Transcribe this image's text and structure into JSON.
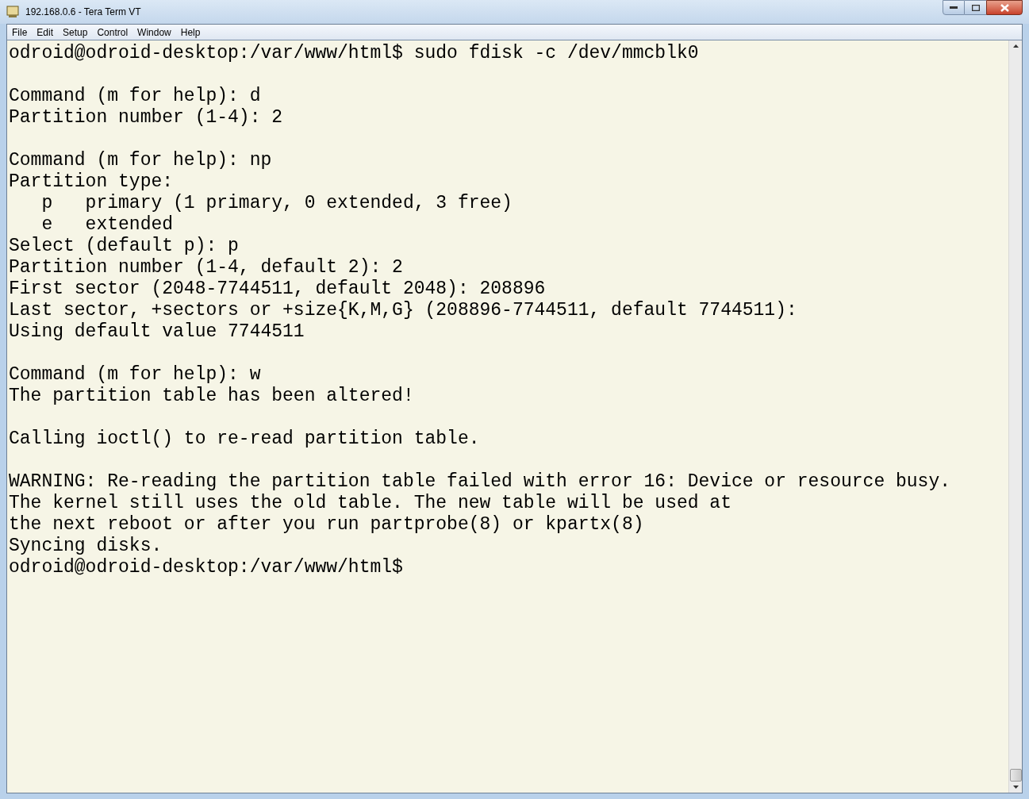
{
  "window": {
    "title": "192.168.0.6 - Tera Term VT"
  },
  "menu": [
    "File",
    "Edit",
    "Setup",
    "Control",
    "Window",
    "Help"
  ],
  "terminal": {
    "blocks": [
      [
        "odroid@odroid-desktop:/var/www/html$ sudo fdisk -c /dev/mmcblk0"
      ],
      [
        "Command (m for help): d",
        "Partition number (1-4): 2"
      ],
      [
        "Command (m for help): np",
        "Partition type:",
        "   p   primary (1 primary, 0 extended, 3 free)",
        "   e   extended",
        "Select (default p): p",
        "Partition number (1-4, default 2): 2",
        "First sector (2048-7744511, default 2048): 208896",
        "Last sector, +sectors or +size{K,M,G} (208896-7744511, default 7744511):",
        "Using default value 7744511"
      ],
      [
        "Command (m for help): w",
        "The partition table has been altered!"
      ],
      [
        "Calling ioctl() to re-read partition table."
      ],
      [
        "WARNING: Re-reading the partition table failed with error 16: Device or resource busy.",
        "The kernel still uses the old table. The new table will be used at",
        "the next reboot or after you run partprobe(8) or kpartx(8)",
        "Syncing disks.",
        "odroid@odroid-desktop:/var/www/html$"
      ]
    ]
  }
}
